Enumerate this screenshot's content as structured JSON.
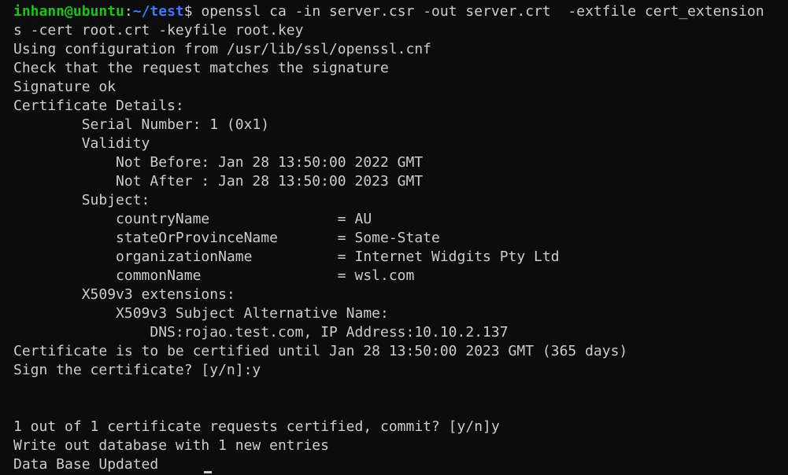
{
  "terminal": {
    "prompt": {
      "user_host": "inhann@ubuntu",
      "separator": ":",
      "path": "~/test",
      "symbol": "$"
    },
    "command": " openssl ca -in server.csr -out server.crt  -extfile cert_extension",
    "command_wrap": "s -cert root.crt -keyfile root.key",
    "output": [
      "Using configuration from /usr/lib/ssl/openssl.cnf",
      "Check that the request matches the signature",
      "Signature ok",
      "Certificate Details:",
      "        Serial Number: 1 (0x1)",
      "        Validity",
      "            Not Before: Jan 28 13:50:00 2022 GMT",
      "            Not After : Jan 28 13:50:00 2023 GMT",
      "        Subject:",
      "            countryName               = AU",
      "            stateOrProvinceName       = Some-State",
      "            organizationName          = Internet Widgits Pty Ltd",
      "            commonName                = wsl.com",
      "        X509v3 extensions:",
      "            X509v3 Subject Alternative Name:",
      "                DNS:rojao.test.com, IP Address:10.10.2.137",
      "Certificate is to be certified until Jan 28 13:50:00 2023 GMT (365 days)",
      "Sign the certificate? [y/n]:y",
      "",
      "",
      "1 out of 1 certificate requests certified, commit? [y/n]y",
      "Write out database with 1 new entries",
      "Data Base Updated"
    ]
  },
  "colors": {
    "background": "#0c0c0c",
    "text": "#cccccc",
    "prompt_user": "#16c60c",
    "prompt_path": "#3b78ff"
  }
}
